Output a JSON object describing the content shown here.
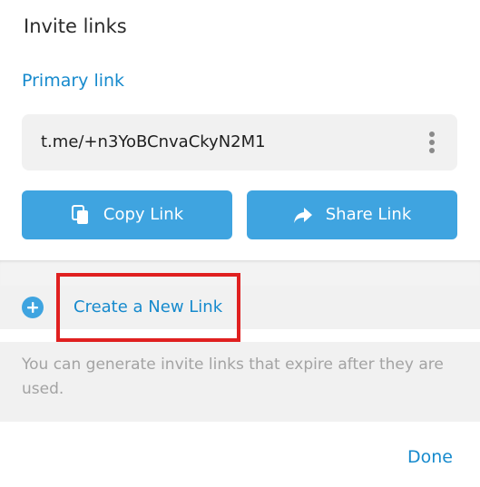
{
  "dialog": {
    "title": "Invite links",
    "primary_heading": "Primary link",
    "link_value": "t.me/+n3YoBCnvaCkyN2M1",
    "copy_label": "Copy Link",
    "share_label": "Share Link",
    "create_label": "Create a New Link",
    "info_text": "You can generate invite links that expire after they are used.",
    "done_label": "Done"
  },
  "icons": {
    "more": "more-vertical-icon",
    "copy": "copy-icon",
    "share": "share-arrow-icon",
    "add": "plus-circle-icon"
  },
  "colors": {
    "accent": "#168acd",
    "button_bg": "#3fa4e0",
    "highlight": "#e02020",
    "muted_text": "#a3a3a3"
  }
}
